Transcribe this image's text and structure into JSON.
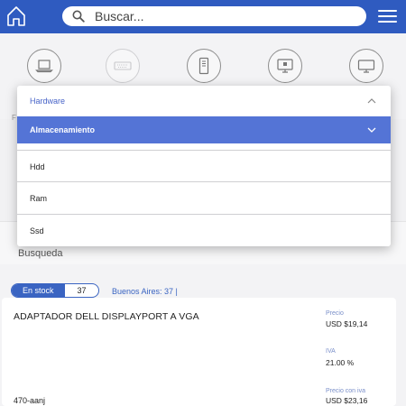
{
  "header": {
    "search_placeholder": "Buscar...",
    "home_icon": "home-icon",
    "search_icon": "search-icon",
    "menu_icon": "hamburger-menu-icon"
  },
  "categories": [
    {
      "icon": "laptop-icon"
    },
    {
      "icon": "keyboard-icon"
    },
    {
      "icon": "tower-pc-icon"
    },
    {
      "icon": "all-in-one-pc-icon"
    },
    {
      "icon": "monitor-icon"
    }
  ],
  "dropdown": {
    "label": "Hardware",
    "selected": "Almacenamiento",
    "options": [
      "Hdd",
      "Ram",
      "Ssd"
    ]
  },
  "search_section": {
    "label": "Busqueda"
  },
  "product": {
    "stock_label": "En stock",
    "stock_count": "37",
    "location": "Buenos Aires: 37 |",
    "name": "ADAPTADOR DELL DISPLAYPORT A VGA",
    "code": "470-aanj",
    "price_label": "Precio",
    "price_value": "USD $19,14",
    "iva_label": "IVA",
    "iva_value": "21.00 %",
    "price_iva_label": "Precio con iva",
    "price_iva_value": "USD $23,16"
  },
  "colors": {
    "header_blue": "#2f5bc0",
    "selected_blue": "#5474d6",
    "accent_text": "#4763c8"
  }
}
